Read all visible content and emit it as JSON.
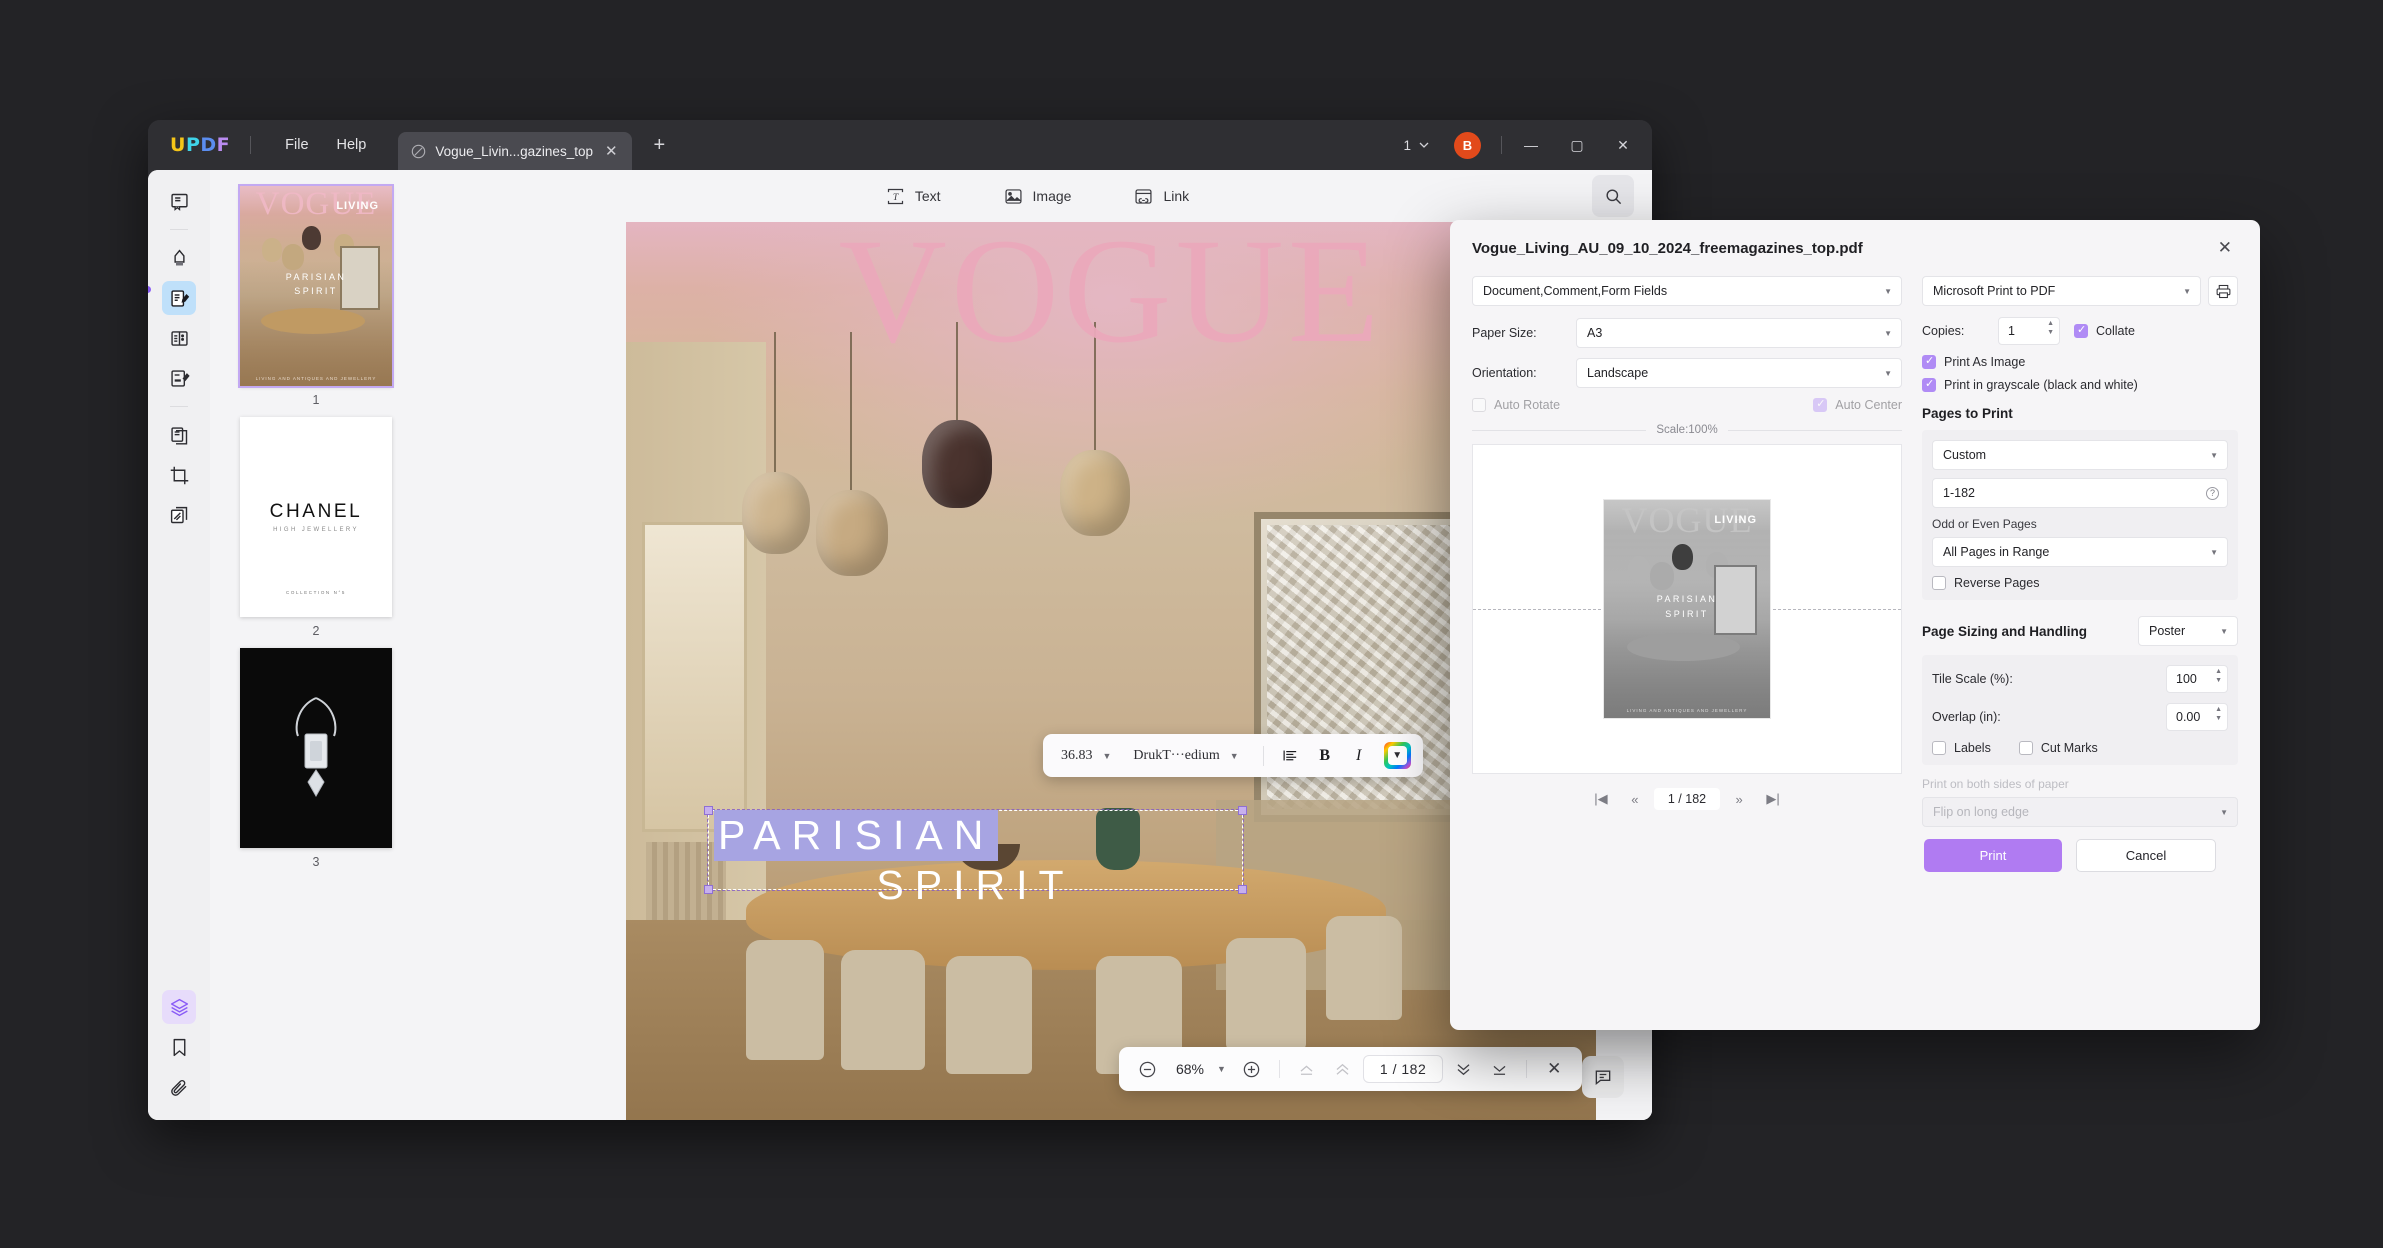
{
  "app": {
    "logo_letters": [
      "U",
      "P",
      "D",
      "F"
    ],
    "menus": [
      "File",
      "Help"
    ],
    "tab": {
      "title": "Vogue_Livin...gazines_top",
      "close": "✕",
      "file_icon": "pdf-file-icon"
    },
    "new_tab": "+",
    "page_selector": "1",
    "avatar_initial": "B",
    "window_controls": {
      "minimize": "—",
      "maximize": "▢",
      "close": "✕"
    }
  },
  "left_rail": {
    "items": [
      {
        "name": "reader-mode-icon",
        "label": "Reader"
      },
      {
        "name": "highlight-icon",
        "label": "Annotate"
      },
      {
        "name": "edit-pdf-icon",
        "label": "Edit PDF"
      },
      {
        "name": "organize-pages-icon",
        "label": "Organize Pages"
      },
      {
        "name": "form-icon",
        "label": "Form"
      },
      {
        "name": "convert-icon",
        "label": "Convert"
      },
      {
        "name": "crop-icon",
        "label": "Crop"
      },
      {
        "name": "ocr-icon",
        "label": "OCR"
      },
      {
        "name": "layers-icon",
        "label": "Layers"
      },
      {
        "name": "bookmark-icon",
        "label": "Bookmark"
      },
      {
        "name": "attachment-icon",
        "label": "Attachment"
      }
    ]
  },
  "thumbnails": [
    {
      "number": "1",
      "selected": true,
      "cover_title": "VOGUE",
      "cover_sub": "LIVING",
      "headline_1": "PARISIAN",
      "headline_2": "SPIRIT",
      "footer": "LIVING AND ANTIQUES AND JEWELLERY"
    },
    {
      "number": "2",
      "selected": false,
      "brand": "CHANEL",
      "brand_sub": "HIGH JEWELLERY",
      "footer": "COLLECTION N°5"
    },
    {
      "number": "3",
      "selected": false
    }
  ],
  "viewer_toolbar": {
    "items": [
      {
        "label": "Text",
        "icon": "text-icon"
      },
      {
        "label": "Image",
        "icon": "image-icon"
      },
      {
        "label": "Link",
        "icon": "link-icon"
      }
    ],
    "search_icon": "search-icon"
  },
  "document": {
    "cover_title": "VOGUE",
    "cover_sub": "LIVING",
    "headline_1": "PARISIAN",
    "headline_2": "SPIRIT"
  },
  "text_toolbar": {
    "font_size": "36.83",
    "font_family": "DrukT···edium",
    "align_icon": "align-left-icon",
    "bold": "B",
    "italic": "I",
    "color_picker_icon": "color-picker-chevron-icon"
  },
  "page_bar": {
    "zoom_out": "−",
    "zoom_level": "68%",
    "zoom_in": "+",
    "first_page_icon": "first-page-icon",
    "prev_page_icon": "prev-page-icon",
    "current_page": "1 / 182",
    "next_page_icon": "next-page-icon",
    "last_page_icon": "last-page-icon",
    "close": "✕",
    "comment_icon": "comment-icon"
  },
  "print_dialog": {
    "title": "Vogue_Living_AU_09_10_2024_freemagazines_top.pdf",
    "close": "✕",
    "content_select": "Document,Comment,Form Fields",
    "paper_size": {
      "label": "Paper Size:",
      "value": "A3"
    },
    "orientation": {
      "label": "Orientation:",
      "value": "Landscape"
    },
    "auto_rotate": {
      "label": "Auto Rotate",
      "checked": false
    },
    "auto_center": {
      "label": "Auto Center",
      "checked": true
    },
    "scale_text": "Scale:100%",
    "preview_nav": {
      "first": "|◀",
      "prev": "«",
      "page": "1 / 182",
      "next": "»",
      "last": "▶|"
    },
    "printer": "Microsoft Print to PDF",
    "printer_settings_icon": "printer-icon",
    "copies": {
      "label": "Copies:",
      "value": "1"
    },
    "collate": {
      "label": "Collate",
      "checked": true
    },
    "print_as_image": {
      "label": "Print As Image",
      "checked": true
    },
    "print_grayscale": {
      "label": "Print in grayscale (black and white)",
      "checked": true
    },
    "pages_to_print": {
      "heading": "Pages to Print",
      "mode": "Custom",
      "range": "1-182",
      "odd_even_label": "Odd or Even Pages",
      "odd_even_value": "All Pages in Range",
      "reverse": {
        "label": "Reverse Pages",
        "checked": false
      }
    },
    "page_sizing": {
      "heading": "Page Sizing and Handling",
      "mode": "Poster",
      "tile_scale": {
        "label": "Tile Scale (%):",
        "value": "100"
      },
      "overlap": {
        "label": "Overlap (in):",
        "value": "0.00"
      },
      "labels": {
        "label": "Labels",
        "checked": false
      },
      "cut_marks": {
        "label": "Cut Marks",
        "checked": false
      }
    },
    "duplex_label": "Print on both sides of paper",
    "duplex_value": "Flip on long edge",
    "print_button": "Print",
    "cancel_button": "Cancel"
  }
}
